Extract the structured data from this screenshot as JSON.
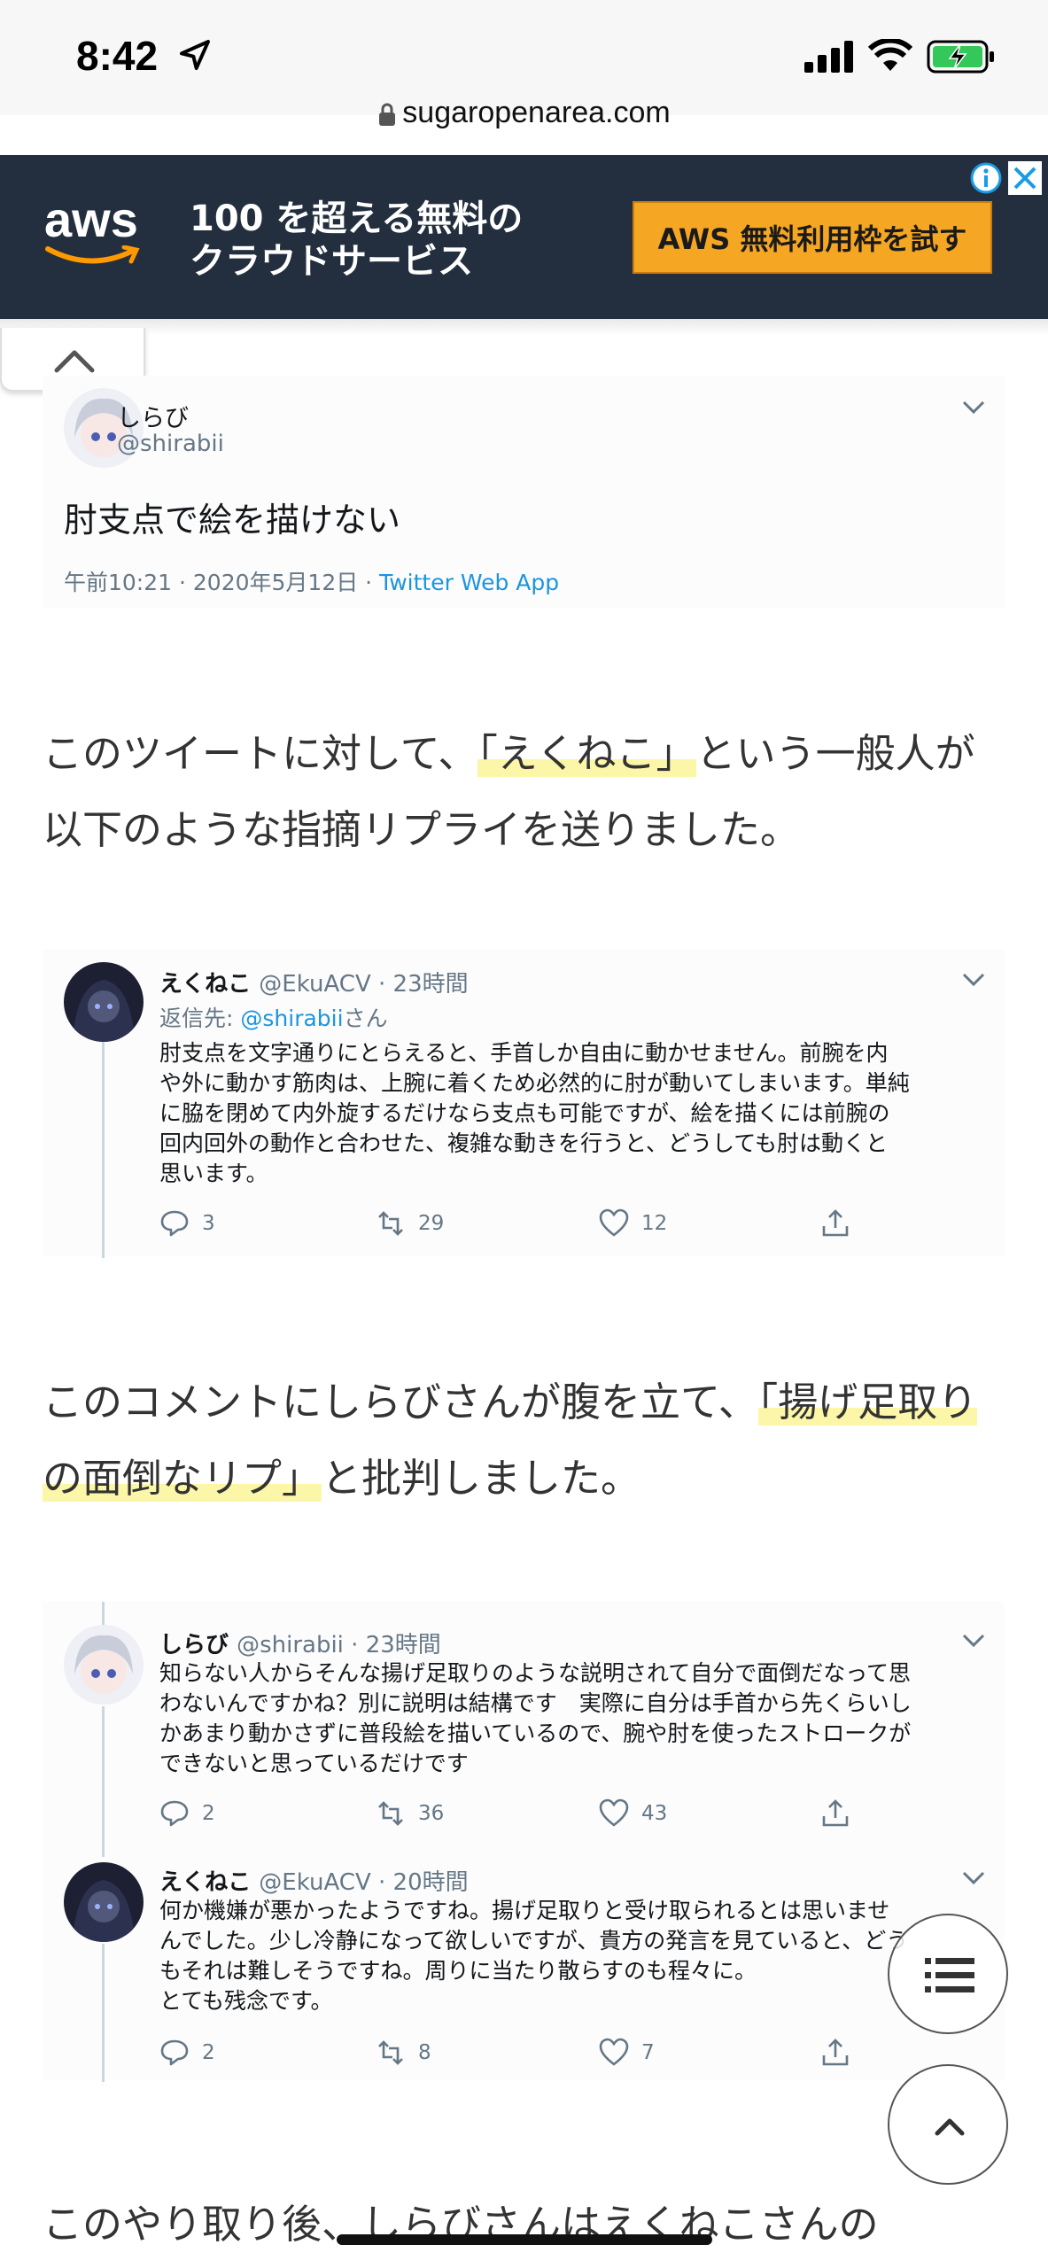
{
  "status_bar": {
    "time": "8:42",
    "url": "sugaropenarea.com",
    "icons": [
      "location-arrow-icon",
      "signal-icon",
      "wifi-icon",
      "battery-charging-icon"
    ]
  },
  "ad": {
    "logo": "aws",
    "line1": "100 を超える無料の",
    "line2": "クラウドサービス",
    "cta": "AWS 無料利用枠を試す",
    "colors": {
      "background": "#232f3e",
      "cta": "#f5a623"
    }
  },
  "tweet1": {
    "name": "しらび",
    "handle": "@shirabii",
    "text": "肘支点で絵を描けない",
    "time": "午前10:21 · 2020年5月12日 · ",
    "source": "Twitter Web App"
  },
  "article": {
    "p1_a": "このツイートに対して、",
    "p1_highlight": "「えくねこ」",
    "p1_b": "という一般人が以下のような指摘リプライを送りました。",
    "p2_a": "このコメントにしらびさんが腹を立て、",
    "p2_highlight": "「揚げ足取りの面倒なリプ」",
    "p2_b": "と批判しました。",
    "p3": "このやり取り後、しらびさんはえくねこさんの"
  },
  "tweet2": {
    "name": "えくねこ",
    "handle": "@EkuACV · 23時間",
    "reply_prefix": "返信先: ",
    "reply_handle": "@shirabii",
    "reply_suffix": "さん",
    "lines": [
      "肘支点を文字通りにとらえると、手首しか自由に動かせません。前腕を内",
      "や外に動かす筋肉は、上腕に着くため必然的に肘が動いてしまいます。単純",
      "に脇を閉めて内外旋するだけなら支点も可能ですが、絵を描くには前腕の",
      "回内回外の動作と合わせた、複雑な動きを行うと、どうしても肘は動くと",
      "思います。"
    ],
    "replies": "3",
    "retweets": "29",
    "likes": "12"
  },
  "tweet3": {
    "name": "しらび",
    "handle": "@shirabii · 23時間",
    "lines": [
      "知らない人からそんな揚げ足取りのような説明されて自分で面倒だなって思",
      "わないんですかね？別に説明は結構です　実際に自分は手首から先くらいし",
      "かあまり動かさずに普段絵を描いているので、腕や肘を使ったストロークが",
      "できないと思っているだけです"
    ],
    "replies": "2",
    "retweets": "36",
    "likes": "43"
  },
  "tweet4": {
    "name": "えくねこ",
    "handle": "@EkuACV · 20時間",
    "lines": [
      "何か機嫌が悪かったようですね。揚げ足取りと受け取られるとは思いませ",
      "んでした。少し冷静になって欲しいですが、貴方の発言を見ていると、どう",
      "もそれは難しそうですね。周りに当たり散らすのも程々に。",
      "とても残念です。"
    ],
    "replies": "2",
    "retweets": "8",
    "likes": "7"
  },
  "floating": [
    "table-of-contents-icon",
    "scroll-to-top-icon"
  ]
}
